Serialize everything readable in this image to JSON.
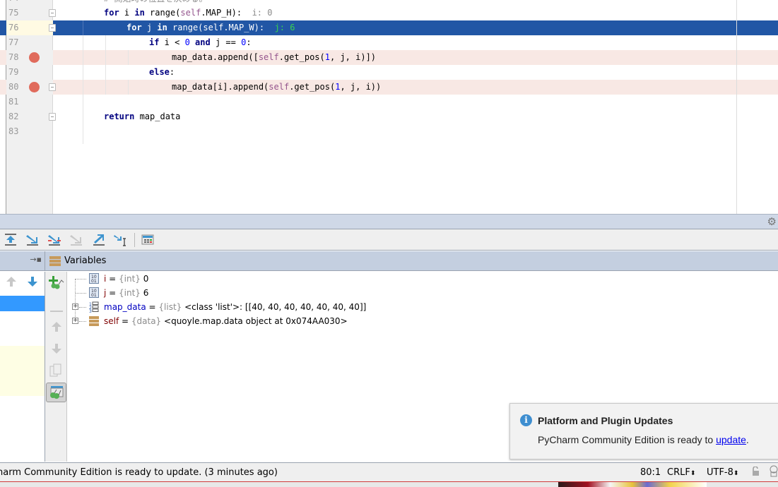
{
  "editor": {
    "partial_top_comment": "# 開始時の位置を決める。",
    "lines": [
      {
        "num": "75",
        "tokens": [
          [
            "kw",
            "for"
          ],
          [
            "t",
            " i "
          ],
          [
            "kw",
            "in"
          ],
          [
            "t",
            " range("
          ],
          [
            "self",
            "self"
          ],
          [
            "t",
            ".MAP_H):  "
          ],
          [
            "val",
            "i: 0"
          ]
        ]
      },
      {
        "num": "76",
        "tokens": [
          [
            "kw",
            "for"
          ],
          [
            "t",
            " j "
          ],
          [
            "kw",
            "in"
          ],
          [
            "t",
            " range("
          ],
          [
            "self",
            "self"
          ],
          [
            "t",
            ".MAP_W):  "
          ],
          [
            "val",
            "j: 6"
          ]
        ]
      },
      {
        "num": "77",
        "tokens": [
          [
            "kw",
            "if"
          ],
          [
            "t",
            " i < "
          ],
          [
            "num",
            "0"
          ],
          [
            "t",
            " "
          ],
          [
            "kw",
            "and"
          ],
          [
            "t",
            " j == "
          ],
          [
            "num",
            "0"
          ],
          [
            "t",
            ":"
          ]
        ]
      },
      {
        "num": "78",
        "tokens": [
          [
            "t",
            "map_data.append(["
          ],
          [
            "self",
            "self"
          ],
          [
            "t",
            ".get_pos("
          ],
          [
            "num",
            "1"
          ],
          [
            "t",
            ", j, i)])"
          ]
        ]
      },
      {
        "num": "79",
        "tokens": [
          [
            "kw",
            "else"
          ],
          [
            "t",
            ":"
          ]
        ]
      },
      {
        "num": "80",
        "tokens": [
          [
            "t",
            "map_data[i].append("
          ],
          [
            "self",
            "self"
          ],
          [
            "t",
            ".get_pos("
          ],
          [
            "num",
            "1"
          ],
          [
            "t",
            ", j, i))"
          ]
        ]
      },
      {
        "num": "81",
        "tokens": []
      },
      {
        "num": "82",
        "tokens": [
          [
            "kw",
            "return"
          ],
          [
            "t",
            " map_data"
          ]
        ]
      },
      {
        "num": "83",
        "tokens": []
      }
    ]
  },
  "debug": {
    "toolbar": [
      {
        "name": "show-execution-point",
        "icon": "show-execution-point-icon"
      },
      {
        "name": "step-over",
        "icon": "step-over-icon"
      },
      {
        "name": "step-into",
        "icon": "step-into-icon"
      },
      {
        "name": "step-into-my-code",
        "icon": "step-into-my-code-icon"
      },
      {
        "name": "step-out",
        "icon": "step-out-icon"
      },
      {
        "name": "run-to-cursor",
        "icon": "run-to-cursor-icon"
      },
      {
        "name": "evaluate-expression",
        "icon": "evaluate-expression-icon"
      }
    ],
    "variables_title": "Variables",
    "variables": [
      {
        "name": "i",
        "type": "{int}",
        "value": "0",
        "icon": "int-icon",
        "expandable": false
      },
      {
        "name": "j",
        "type": "{int}",
        "value": "6",
        "icon": "int-icon",
        "expandable": false
      },
      {
        "name": "map_data",
        "type": "{list}",
        "value": "<class 'list'>: [[40, 40, 40, 40, 40, 40, 40]]",
        "icon": "list-icon",
        "expandable": true
      },
      {
        "name": "self",
        "type": "{data}",
        "value": "<quoyle.map.data object at 0x074AA030>",
        "icon": "object-icon",
        "expandable": true
      }
    ]
  },
  "notification": {
    "title": "Platform and Plugin Updates",
    "body_prefix": "PyCharm Community Edition is ready to ",
    "link": "update",
    "body_suffix": "."
  },
  "statusbar": {
    "message": "harm Community Edition is ready to update. (3 minutes ago)",
    "position": "80:1",
    "line_separator": "CRLF",
    "encoding": "UTF-8"
  }
}
